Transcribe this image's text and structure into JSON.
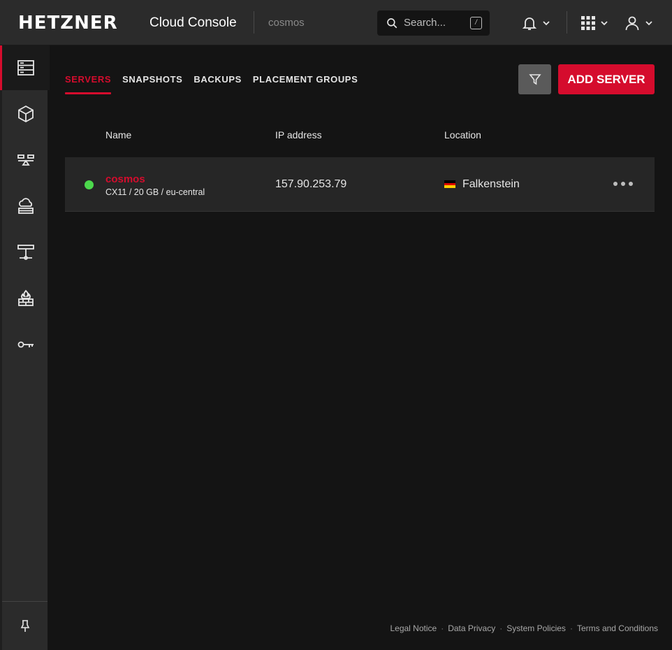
{
  "topbar": {
    "logo": "HETZNER",
    "app_title": "Cloud Console",
    "project": "cosmos",
    "search_placeholder": "Search...",
    "search_shortcut": "/"
  },
  "sidebar": {
    "items": [
      {
        "name": "servers",
        "icon": "server-icon",
        "active": true
      },
      {
        "name": "volumes",
        "icon": "cube-icon",
        "active": false
      },
      {
        "name": "load-balancers",
        "icon": "load-balancer-icon",
        "active": false
      },
      {
        "name": "floating-ips",
        "icon": "cloud-network-icon",
        "active": false
      },
      {
        "name": "networks",
        "icon": "network-icon",
        "active": false
      },
      {
        "name": "firewalls",
        "icon": "firewall-icon",
        "active": false
      },
      {
        "name": "security",
        "icon": "key-icon",
        "active": false
      }
    ],
    "pin_icon": "pin-icon"
  },
  "main": {
    "tabs": [
      {
        "label": "SERVERS",
        "active": true
      },
      {
        "label": "SNAPSHOTS",
        "active": false
      },
      {
        "label": "BACKUPS",
        "active": false
      },
      {
        "label": "PLACEMENT GROUPS",
        "active": false
      }
    ],
    "add_button": "ADD SERVER",
    "columns": {
      "name": "Name",
      "ip": "IP address",
      "location": "Location"
    },
    "servers": [
      {
        "name": "cosmos",
        "spec": "CX11 / 20 GB / eu-central",
        "ip": "157.90.253.79",
        "location": "Falkenstein",
        "status": "running"
      }
    ]
  },
  "footer": {
    "links": [
      "Legal Notice",
      "Data Privacy",
      "System Policies",
      "Terms and Conditions"
    ]
  },
  "colors": {
    "accent": "#d50c2d",
    "status_running": "#4cd84c",
    "background": "#141414",
    "panel": "#2b2b2b"
  }
}
